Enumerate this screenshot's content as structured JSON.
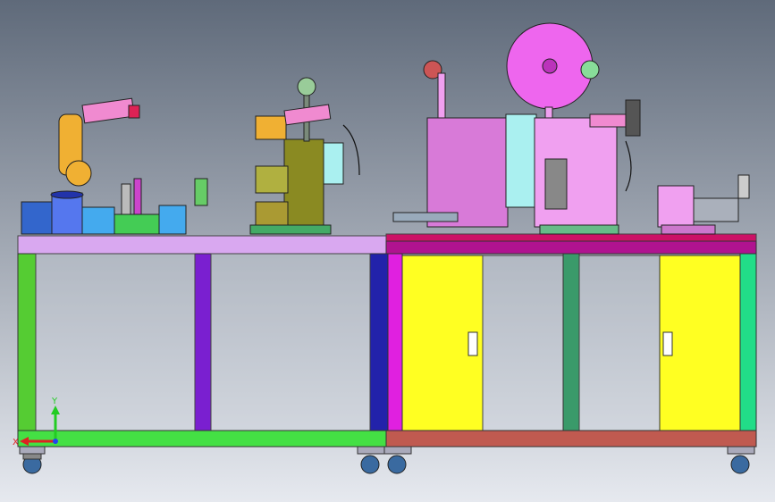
{
  "viewport": {
    "background_top": "#5f6a7a",
    "background_bottom": "#e6e9ef"
  },
  "axes": {
    "y_label": "Y",
    "x_label": "X",
    "y_color": "#22cc22",
    "x_color": "#dd2222",
    "z_color": "#2244ee"
  },
  "colors": {
    "left_table_top": "#d9a8f0",
    "left_leg_green": "#55cc33",
    "left_post_purple": "#7a1fd0",
    "left_post_blue": "#2222aa",
    "left_bottom_rail": "#44e044",
    "right_table_top": "#cc1166",
    "right_table_rail": "#b01390",
    "right_leg_magenta": "#e020e0",
    "door_yellow": "#ffff22",
    "right_post_teal": "#3a9a6a",
    "right_leg_green": "#22dd88",
    "right_bottom_rail": "#c05a50",
    "press_body_pink": "#f0a0f0",
    "press_body_dark_pink": "#d87ad8",
    "reel_magenta": "#ee66ee",
    "olive_machine": "#8a8a22",
    "robot_orange": "#f0b033",
    "robot_pink": "#f08ad0",
    "light_cyan": "#aaf0f0"
  }
}
